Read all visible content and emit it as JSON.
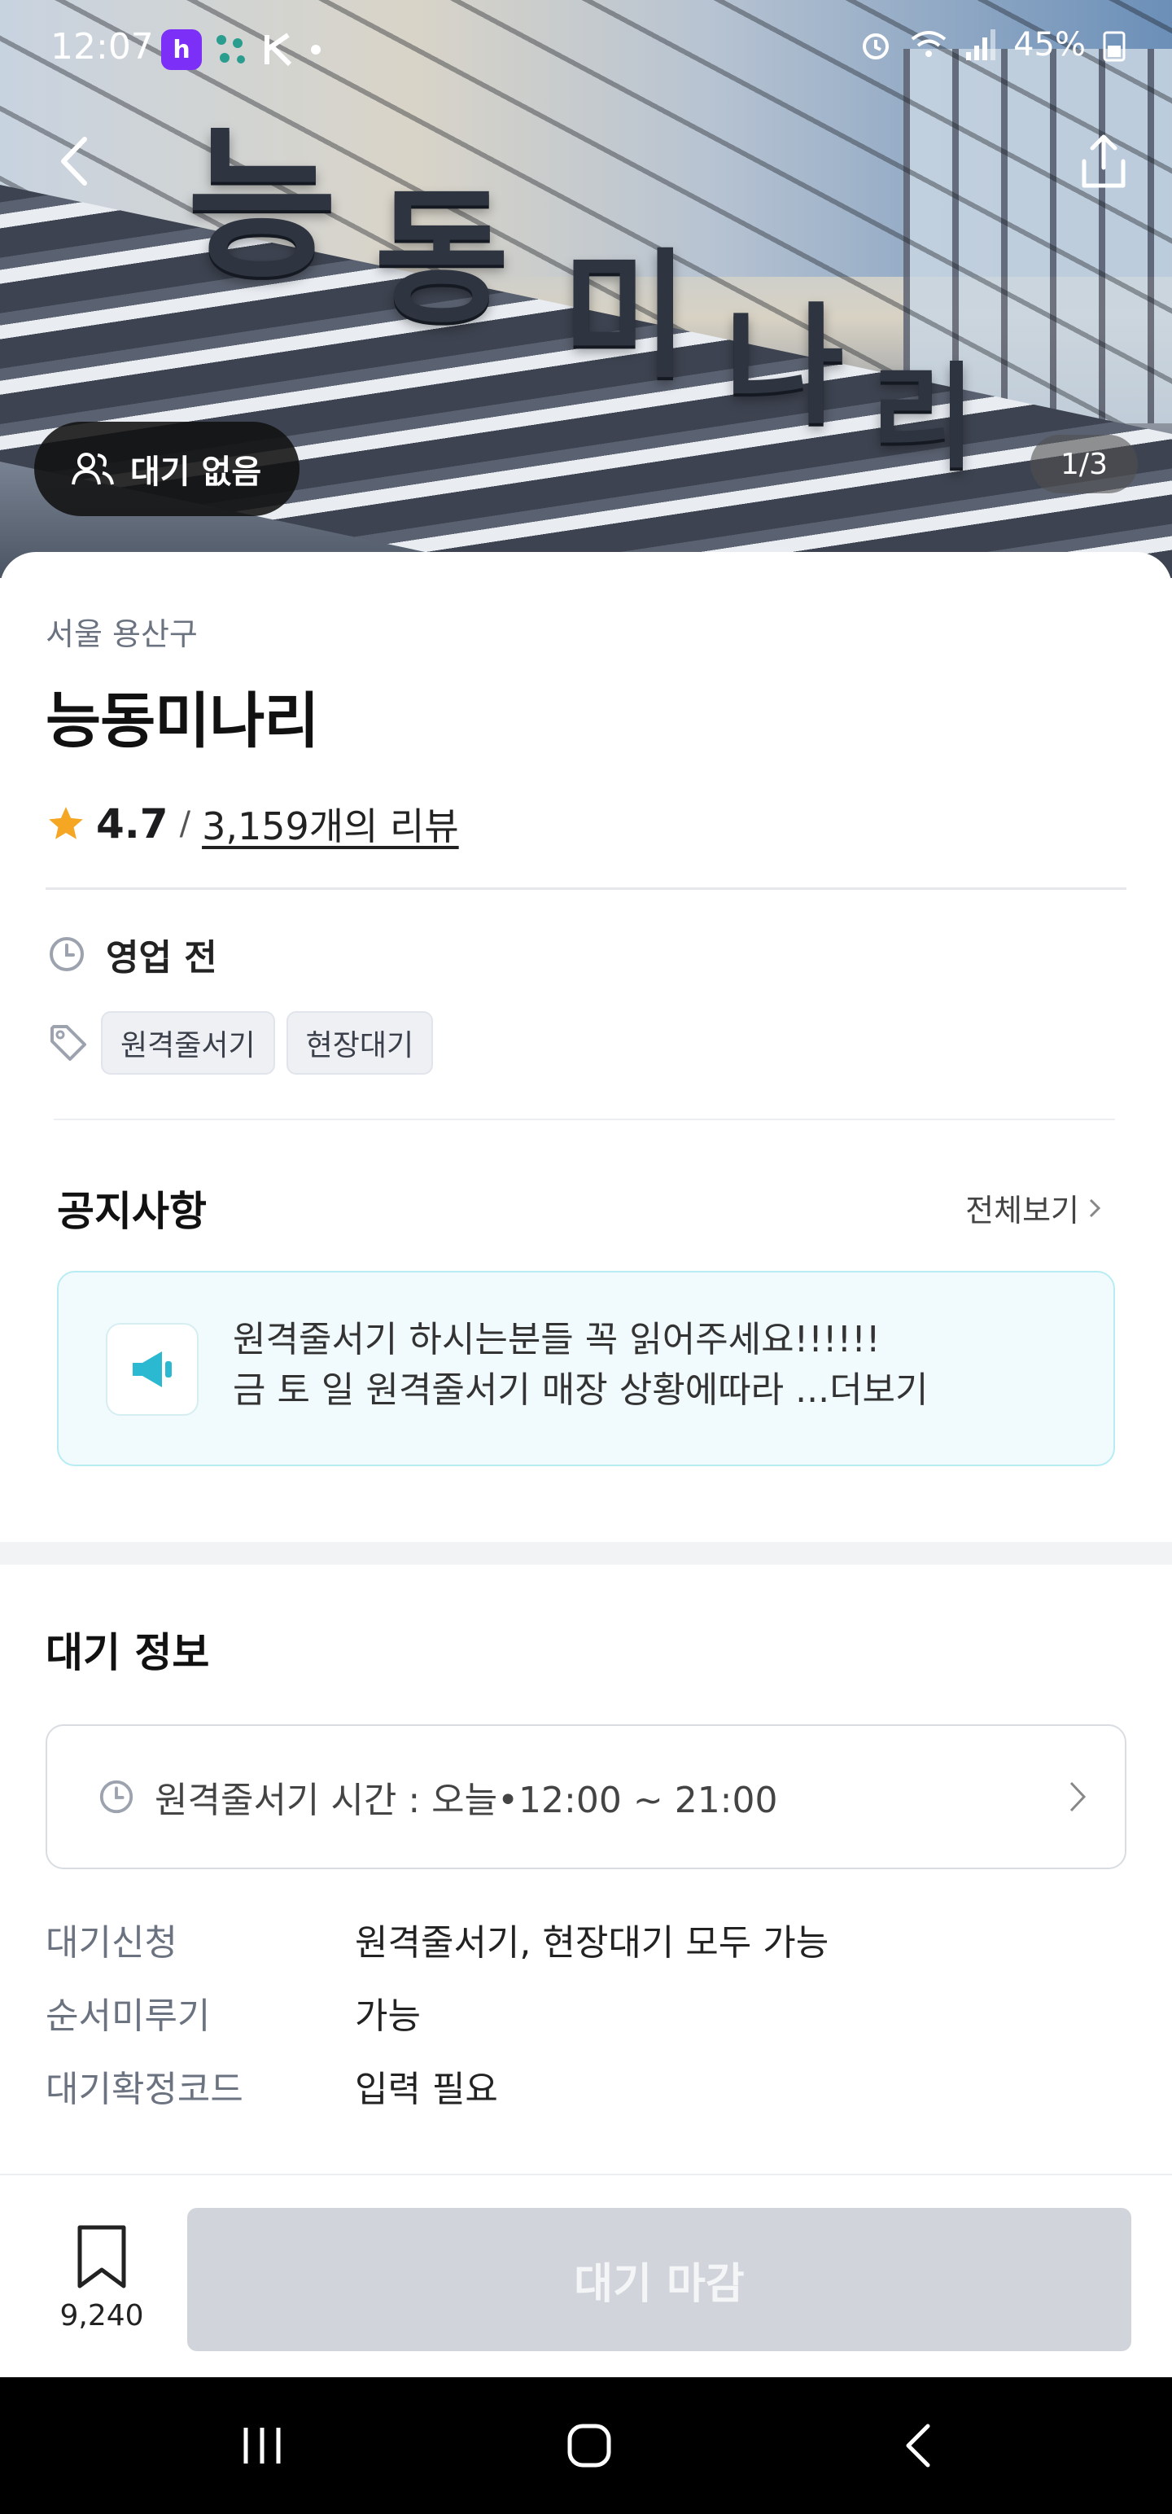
{
  "status_bar": {
    "time": "12:07",
    "app_badge": "h",
    "battery": "45%"
  },
  "hero": {
    "sign_chars": [
      "능",
      "동",
      "미",
      "나",
      "리"
    ],
    "wait_pill_label": "대기 없음",
    "page_counter": "1/3"
  },
  "store": {
    "region": "서울 용산구",
    "name": "능동미나리",
    "rating": "4.7",
    "rating_sep": "/",
    "review_count_label": "3,159개의 리뷰",
    "business_status": "영업 전",
    "tags": [
      "원격줄서기",
      "현장대기"
    ]
  },
  "notice": {
    "title": "공지사항",
    "view_all": "전체보기",
    "line1": "원격줄서기 하시는분들 꼭 읽어주세요!!!!!!",
    "line2": "금 토 일 원격줄서기 매장 상황에따라 ...",
    "more": "더보기"
  },
  "wait_info": {
    "title": "대기 정보",
    "remote_time": "원격줄서기 시간 : 오늘•12:00 ~ 21:00",
    "rows": [
      {
        "key": "대기신청",
        "value": "원격줄서기, 현장대기 모두 가능"
      },
      {
        "key": "순서미루기",
        "value": "가능"
      },
      {
        "key": "대기확정코드",
        "value": "입력 필요"
      }
    ]
  },
  "bottom": {
    "bookmark_count": "9,240",
    "cta_label": "대기 마감"
  },
  "colors": {
    "star": "#f5a623",
    "notice_bg": "#f1fbfd",
    "notice_border": "#b8ecf3",
    "megaphone": "#2bb8d1",
    "cta_disabled": "#d1d5db"
  }
}
